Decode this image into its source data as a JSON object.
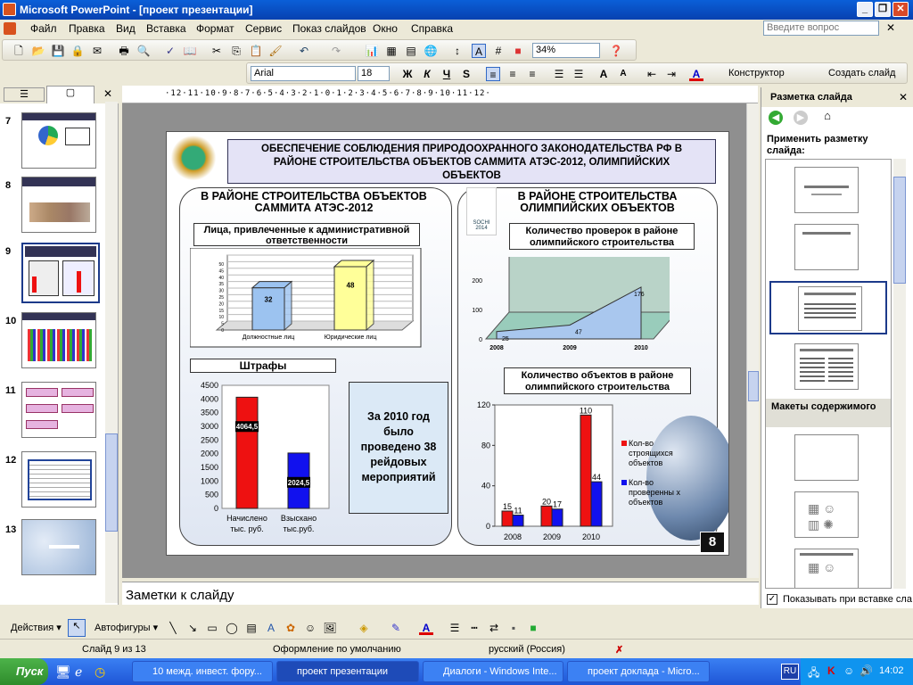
{
  "window": {
    "title": "Microsoft PowerPoint - [проект презентации]",
    "min": "_",
    "restore": "❐",
    "close": "✕"
  },
  "menu": {
    "items": [
      "Файл",
      "Правка",
      "Вид",
      "Вставка",
      "Формат",
      "Сервис",
      "Показ слайдов",
      "Окно",
      "Справка"
    ],
    "ask_placeholder": "Введите вопрос",
    "close": "✕"
  },
  "toolbar": {
    "zoom": "34%",
    "font": "Arial",
    "size": "18",
    "bold": "Ж",
    "italic": "К",
    "underline": "Ч",
    "shadow": "S",
    "designer": "Конструктор",
    "new_slide": "Создать слайд"
  },
  "leftpane": {
    "slides": [
      "7",
      "8",
      "9",
      "10",
      "11",
      "12",
      "13"
    ],
    "close": "✕"
  },
  "ruler": "·12·11·10·9·8·7·6·5·4·3·2·1·0·1·2·3·4·5·6·7·8·9·10·11·12·",
  "slide": {
    "header": "ОБЕСПЕЧЕНИЕ СОБЛЮДЕНИЯ ПРИРОДООХРАННОГО ЗАКОНОДАТЕЛЬСТВА РФ В РАЙОНЕ СТРОИТЕЛЬСТВА ОБЪЕКТОВ САММИТА АТЭС-2012, ОЛИМПИЙСКИХ ОБЪЕКТОВ",
    "left_title": "В РАЙОНЕ СТРОИТЕЛЬСТВА ОБЪЕКТОВ САММИТА АТЭС-2012",
    "right_title": "В РАЙОНЕ СТРОИТЕЛЬСТВА ОЛИМПИЙСКИХ ОБЪЕКТОВ",
    "sochi_label": "SOCHI 2014",
    "persons_label": "Лица, привлеченные к административной ответственности",
    "fines_label": "Штрафы",
    "checks_label": "Количество проверок в районе олимпийского строительства",
    "objects_label": "Количество объектов в районе олимпийского строительства",
    "raids_text": "За 2010 год было проведено 38 рейдовых мероприятий",
    "page_num": "8"
  },
  "chart_data": [
    {
      "type": "bar",
      "title": "Лица, привлеченные к административной ответственности",
      "categories": [
        "Должностные лиц",
        "Юридические лиц"
      ],
      "values": [
        32,
        48
      ],
      "ylim": [
        0,
        50
      ],
      "yticks": [
        "0",
        "5",
        "10",
        "15",
        "20",
        "25",
        "30",
        "35",
        "40",
        "45",
        "50"
      ],
      "colors": [
        "#9cc3f0",
        "#ffff99"
      ]
    },
    {
      "type": "bar",
      "title": "Штрафы",
      "categories": [
        "Начислено тыс. руб.",
        "Взыскано тыс.руб."
      ],
      "values": [
        4064.5,
        2024.5
      ],
      "value_labels": [
        "4064,5",
        "2024,5"
      ],
      "ylim": [
        0,
        4500
      ],
      "yticks": [
        "0",
        "500",
        "1000",
        "1500",
        "2000",
        "2500",
        "3000",
        "3500",
        "4000",
        "4500"
      ],
      "colors": [
        "#ee1111",
        "#1111ee"
      ]
    },
    {
      "type": "area",
      "title": "Количество проверок в районе олимпийского строительства",
      "categories": [
        "2008",
        "2009",
        "2010"
      ],
      "values": [
        25,
        47,
        176
      ],
      "ylim": [
        0,
        200
      ],
      "yticks": [
        "0",
        "100",
        "200"
      ],
      "colors": [
        "#a9c7ee"
      ]
    },
    {
      "type": "bar",
      "title": "Количество объектов в районе олимпийского строительства",
      "categories": [
        "2008",
        "2009",
        "2010"
      ],
      "series": [
        {
          "name": "Кол-во строящихся объектов",
          "values": [
            15,
            20,
            110
          ]
        },
        {
          "name": "Кол-во проверенны х объектов",
          "values": [
            11,
            17,
            44
          ]
        }
      ],
      "ylim": [
        0,
        120
      ],
      "yticks": [
        "0",
        "40",
        "80",
        "120"
      ],
      "colors": [
        "#ee1111",
        "#1111ee"
      ]
    }
  ],
  "notes": {
    "placeholder": "Заметки к слайду"
  },
  "taskpane": {
    "title": "Разметка слайда",
    "close": "✕",
    "apply_label": "Применить разметку слайда:",
    "section2": "Макеты содержимого",
    "show_on_insert": "Показывать при вставке сла"
  },
  "drawbar": {
    "actions": "Действия ▾",
    "autoshapes": "Автофигуры ▾"
  },
  "status": {
    "slide": "Слайд 9 из 13",
    "design": "Оформление по умолчанию",
    "language": "русский (Россия)"
  },
  "taskbar": {
    "start": "Пуск",
    "tasks": [
      "10 межд. инвест. фору...",
      "проект презентации",
      "Диалоги - Windows Inte...",
      "проект доклада - Micro..."
    ],
    "lang": "RU",
    "time": "14:02"
  }
}
